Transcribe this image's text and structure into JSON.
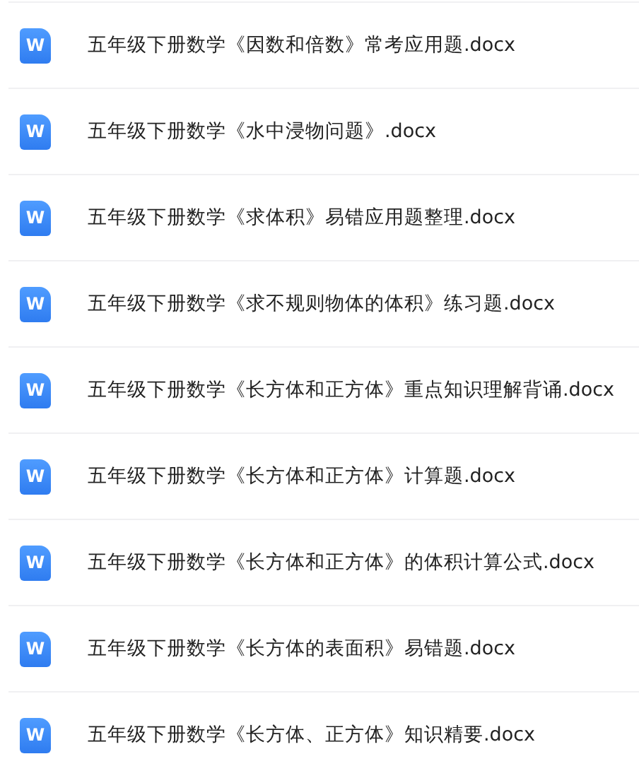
{
  "files": [
    {
      "name": "五年级下册数学《因数和倍数》常考应用题.docx",
      "icon_label": "W"
    },
    {
      "name": "五年级下册数学《水中浸物问题》.docx",
      "icon_label": "W"
    },
    {
      "name": "五年级下册数学《求体积》易错应用题整理.docx",
      "icon_label": "W"
    },
    {
      "name": "五年级下册数学《求不规则物体的体积》练习题.docx",
      "icon_label": "W"
    },
    {
      "name": "五年级下册数学《长方体和正方体》重点知识理解背诵.docx",
      "icon_label": "W"
    },
    {
      "name": "五年级下册数学《长方体和正方体》计算题.docx",
      "icon_label": "W"
    },
    {
      "name": "五年级下册数学《长方体和正方体》的体积计算公式.docx",
      "icon_label": "W"
    },
    {
      "name": "五年级下册数学《长方体的表面积》易错题.docx",
      "icon_label": "W"
    },
    {
      "name": "五年级下册数学《长方体、正方体》知识精要.docx",
      "icon_label": "W"
    }
  ]
}
